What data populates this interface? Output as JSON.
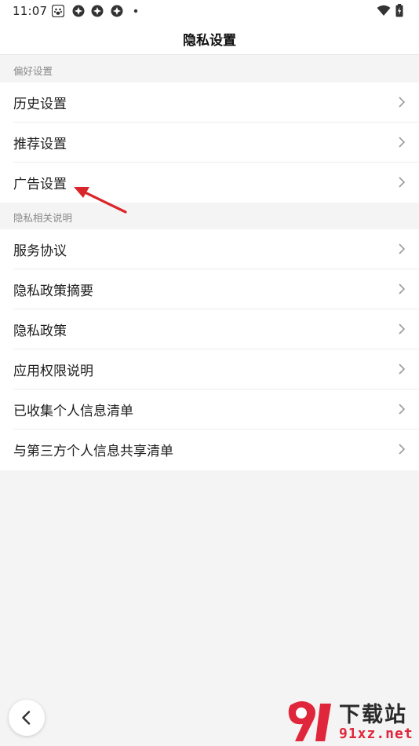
{
  "status_bar": {
    "time": "11:07",
    "icons": [
      "baidu-paw-icon",
      "app-icon",
      "app-icon",
      "app-icon",
      "dot-icon",
      "wifi-icon",
      "battery-icon"
    ]
  },
  "header": {
    "title": "隐私设置"
  },
  "sections": [
    {
      "title": "偏好设置",
      "items": [
        "历史设置",
        "推荐设置",
        "广告设置"
      ]
    },
    {
      "title": "隐私相关说明",
      "items": [
        "服务协议",
        "隐私政策摘要",
        "隐私政策",
        "应用权限说明",
        "已收集个人信息清单",
        "与第三方个人信息共享清单"
      ]
    }
  ],
  "watermark": {
    "title": "下载站",
    "url": "91xz.net"
  },
  "colors": {
    "background": "#f4f4f4",
    "card": "#ffffff",
    "annotation_arrow": "#d9262b",
    "watermark_red": "#e0263a"
  }
}
